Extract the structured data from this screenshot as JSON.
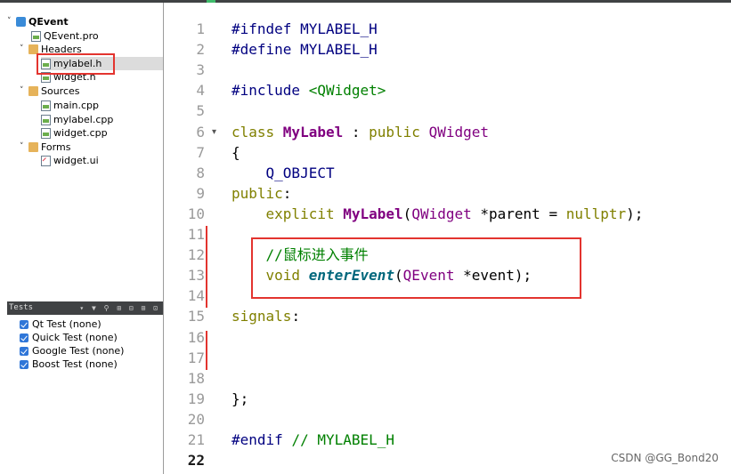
{
  "project_tree": {
    "project": "QEvent",
    "pro_file": "QEvent.pro",
    "headers_folder": "Headers",
    "headers": [
      "mylabel.h",
      "widget.h"
    ],
    "sources_folder": "Sources",
    "sources": [
      "main.cpp",
      "mylabel.cpp",
      "widget.cpp"
    ],
    "forms_folder": "Forms",
    "forms": [
      "widget.ui"
    ],
    "selected_file": "mylabel.h"
  },
  "tests_panel": {
    "title": "Tests",
    "items": [
      "Qt Test (none)",
      "Quick Test (none)",
      "Google Test (none)",
      "Boost Test (none)"
    ]
  },
  "editor": {
    "current_line": 22,
    "lines": [
      {
        "n": "1",
        "parts": [
          {
            "t": "#ifndef MYLABEL_H",
            "c": "mac"
          }
        ]
      },
      {
        "n": "2",
        "parts": [
          {
            "t": "#define MYLABEL_H",
            "c": "mac"
          }
        ]
      },
      {
        "n": "3",
        "parts": []
      },
      {
        "n": "4",
        "parts": [
          {
            "t": "#include ",
            "c": "mac"
          },
          {
            "t": "<QWidget>",
            "c": "str"
          }
        ]
      },
      {
        "n": "5",
        "parts": []
      },
      {
        "n": "6",
        "parts": [
          {
            "t": "class ",
            "c": "kw"
          },
          {
            "t": "MyLabel",
            "c": "cls"
          },
          {
            "t": " : ",
            "c": ""
          },
          {
            "t": "public ",
            "c": "kw"
          },
          {
            "t": "QWidget",
            "c": "typ"
          }
        ]
      },
      {
        "n": "7",
        "parts": [
          {
            "t": "{",
            "c": ""
          }
        ]
      },
      {
        "n": "8",
        "parts": [
          {
            "t": "    Q_OBJECT",
            "c": "mac2"
          }
        ]
      },
      {
        "n": "9",
        "parts": [
          {
            "t": "public",
            "c": "kw"
          },
          {
            "t": ":",
            "c": ""
          }
        ]
      },
      {
        "n": "10",
        "parts": [
          {
            "t": "    explicit ",
            "c": "kw"
          },
          {
            "t": "MyLabel",
            "c": "cls"
          },
          {
            "t": "(",
            "c": ""
          },
          {
            "t": "QWidget",
            "c": "typ"
          },
          {
            "t": " *parent = ",
            "c": ""
          },
          {
            "t": "nullptr",
            "c": "kw"
          },
          {
            "t": ");",
            "c": ""
          }
        ]
      },
      {
        "n": "11",
        "parts": []
      },
      {
        "n": "12",
        "parts": [
          {
            "t": "    //鼠标进入事件",
            "c": "cmt"
          }
        ]
      },
      {
        "n": "13",
        "parts": [
          {
            "t": "    void ",
            "c": "kw"
          },
          {
            "t": "enterEvent",
            "c": "fnc"
          },
          {
            "t": "(",
            "c": ""
          },
          {
            "t": "QEvent",
            "c": "typ"
          },
          {
            "t": " *event);",
            "c": ""
          }
        ]
      },
      {
        "n": "14",
        "parts": []
      },
      {
        "n": "15",
        "parts": [
          {
            "t": "signals",
            "c": "kw"
          },
          {
            "t": ":",
            "c": ""
          }
        ]
      },
      {
        "n": "16",
        "parts": []
      },
      {
        "n": "17",
        "parts": []
      },
      {
        "n": "18",
        "parts": []
      },
      {
        "n": "19",
        "parts": [
          {
            "t": "};",
            "c": ""
          }
        ]
      },
      {
        "n": "20",
        "parts": []
      },
      {
        "n": "21",
        "parts": [
          {
            "t": "#endif ",
            "c": "mac"
          },
          {
            "t": "// MYLABEL_H",
            "c": "cmt"
          }
        ]
      },
      {
        "n": "22",
        "parts": []
      }
    ]
  },
  "watermark": "CSDN @GG_Bond20",
  "colors": {
    "highlight_box": "#e3342f",
    "checkbox": "#2f76d8",
    "toolbar": "#404244"
  }
}
